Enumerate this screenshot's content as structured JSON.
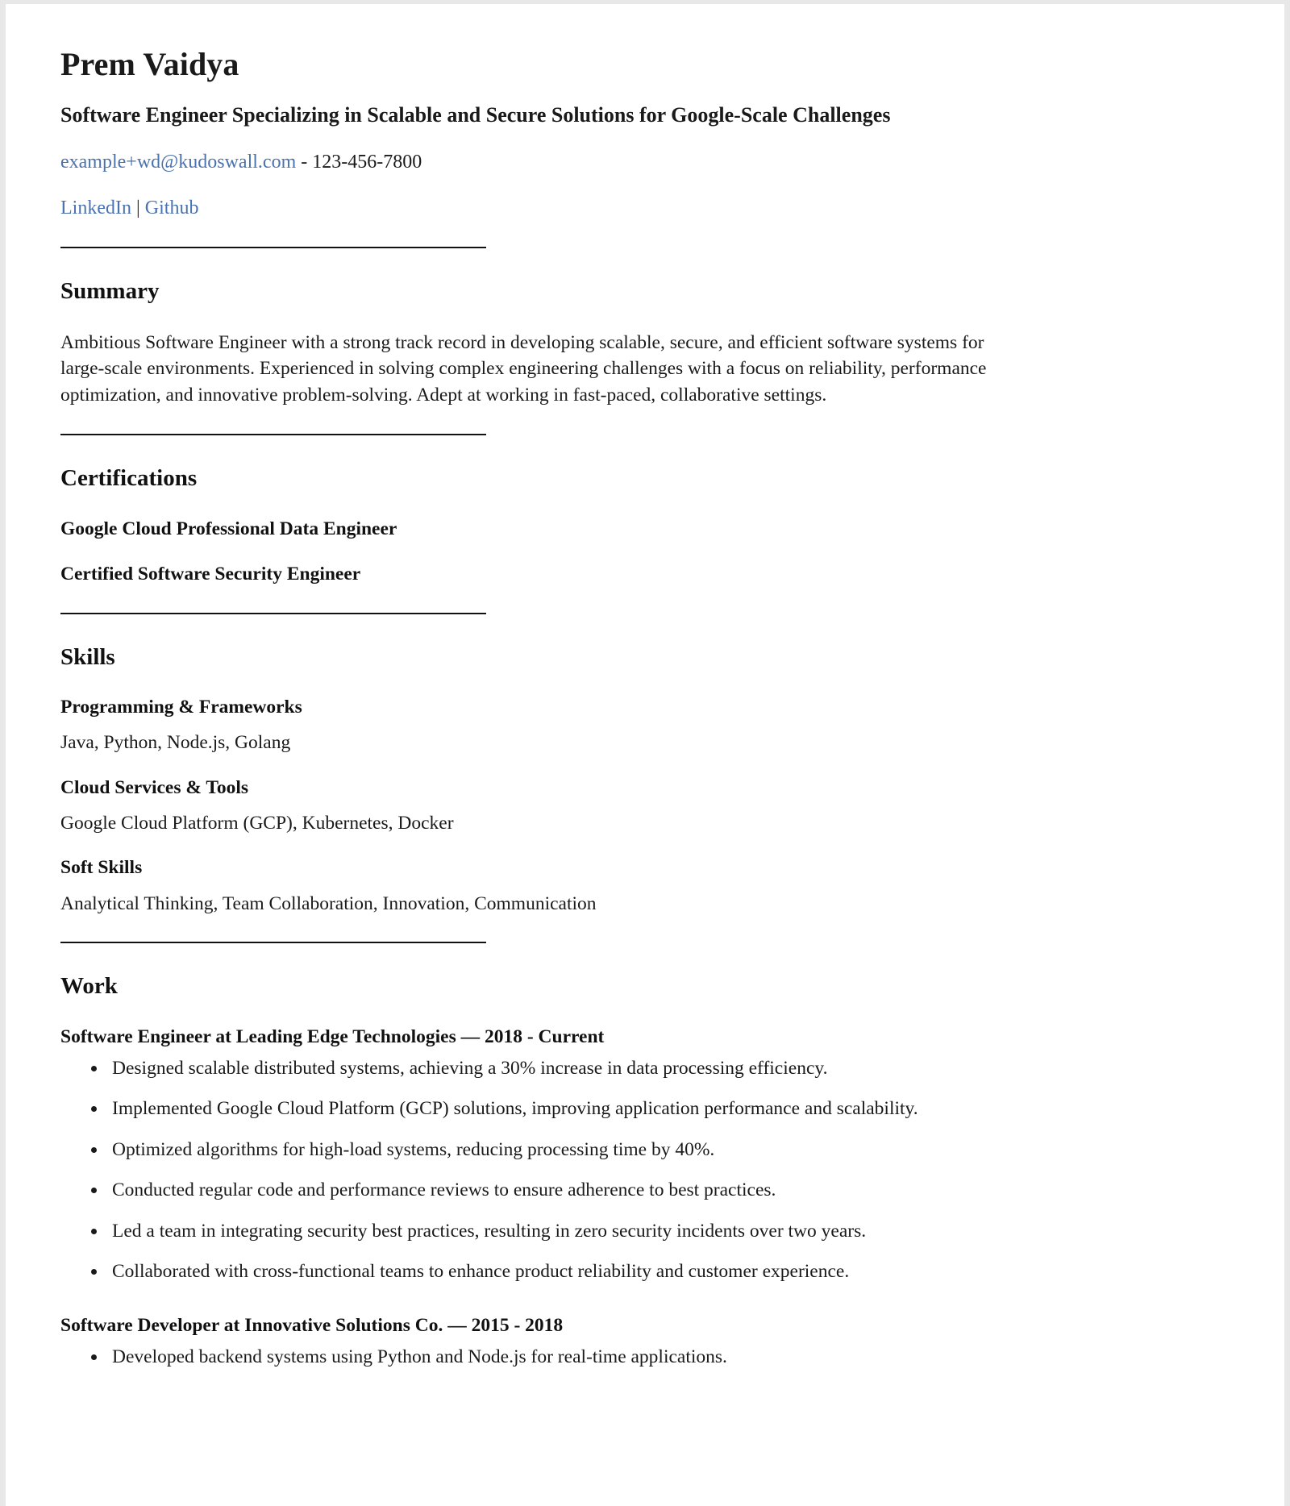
{
  "header": {
    "name": "Prem Vaidya",
    "headline": "Software Engineer Specializing in Scalable and Secure Solutions for Google-Scale Challenges",
    "email": "example+wd@kudoswall.com",
    "contact_separator": " - ",
    "phone": "123-456-7800",
    "links": [
      {
        "label": "LinkedIn"
      },
      {
        "label": "Github"
      }
    ],
    "link_separator": "|"
  },
  "sections": {
    "summary": {
      "title": "Summary",
      "text": "Ambitious Software Engineer with a strong track record in developing scalable, secure, and efficient software systems for large-scale environments. Experienced in solving complex engineering challenges with a focus on reliability, performance optimization, and innovative problem-solving. Adept at working in fast-paced, collaborative settings."
    },
    "certifications": {
      "title": "Certifications",
      "items": [
        "Google Cloud Professional Data Engineer",
        "Certified Software Security Engineer"
      ]
    },
    "skills": {
      "title": "Skills",
      "groups": [
        {
          "label": "Programming & Frameworks",
          "value": "Java, Python, Node.js, Golang"
        },
        {
          "label": "Cloud Services & Tools",
          "value": "Google Cloud Platform (GCP), Kubernetes, Docker"
        },
        {
          "label": "Soft Skills",
          "value": "Analytical Thinking, Team Collaboration, Innovation, Communication"
        }
      ]
    },
    "work": {
      "title": "Work",
      "jobs": [
        {
          "title": "Software Engineer at Leading Edge Technologies — 2018 - Current",
          "bullets": [
            "Designed scalable distributed systems, achieving a 30% increase in data processing efficiency.",
            "Implemented Google Cloud Platform (GCP) solutions, improving application performance and scalability.",
            "Optimized algorithms for high-load systems, reducing processing time by 40%.",
            "Conducted regular code and performance reviews to ensure adherence to best practices.",
            "Led a team in integrating security best practices, resulting in zero security incidents over two years.",
            "Collaborated with cross-functional teams to enhance product reliability and customer experience."
          ]
        },
        {
          "title": "Software Developer at Innovative Solutions Co. — 2015 - 2018",
          "bullets": [
            "Developed backend systems using Python and Node.js for real-time applications."
          ]
        }
      ]
    }
  },
  "colors": {
    "link": "#4a72b0",
    "text": "#1a1a1a",
    "rule": "#111111",
    "page_background": "#ffffff",
    "canvas_background": "#e8e8e8"
  }
}
